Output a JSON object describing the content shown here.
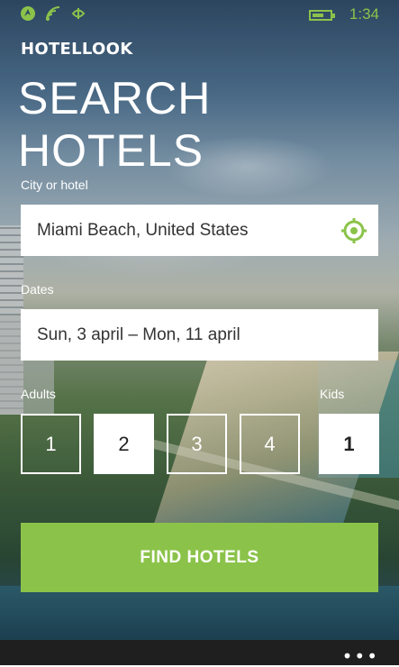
{
  "status_bar": {
    "time": "1:34",
    "icons": [
      "location-icon",
      "wifi-icon",
      "signal-icon",
      "battery-icon"
    ]
  },
  "brand": "HOTELLOOK",
  "title": "SEARCH HOTELS",
  "city": {
    "label": "City or hotel",
    "value": "Miami Beach, United States",
    "icon": "target-icon"
  },
  "dates": {
    "label": "Dates",
    "value": "Sun, 3 april – Mon, 11 april"
  },
  "adults": {
    "label": "Adults",
    "options": [
      "1",
      "2",
      "3",
      "4"
    ],
    "selected": "2"
  },
  "kids": {
    "label": "Kids",
    "value": "1"
  },
  "action": {
    "find_label": "FIND HOTELS"
  },
  "colors": {
    "accent": "#8bc34a"
  }
}
